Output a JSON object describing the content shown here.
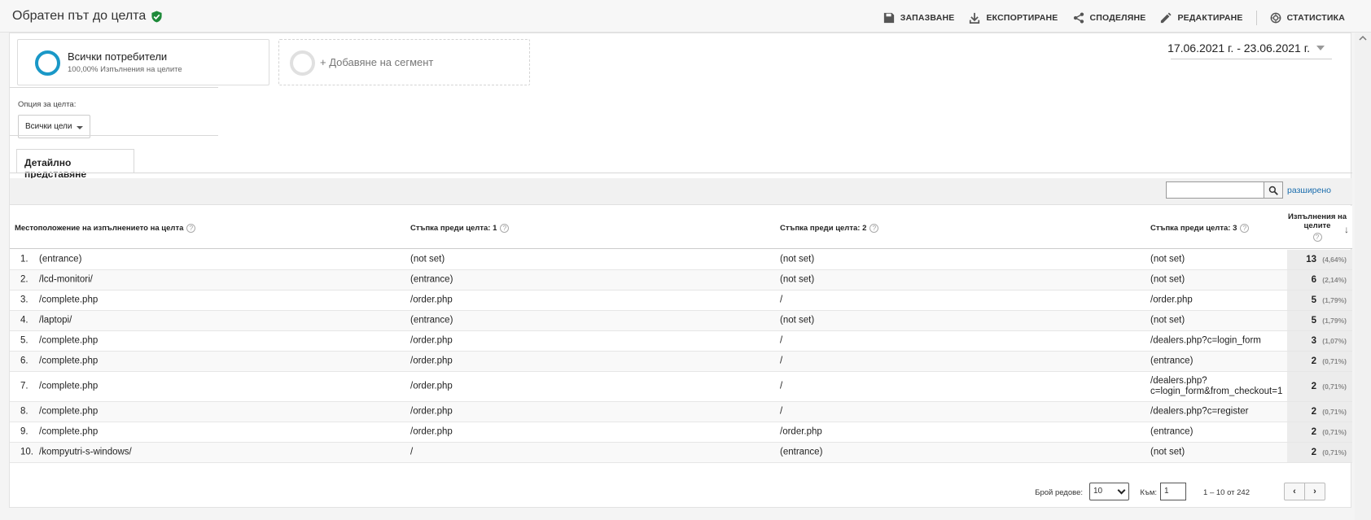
{
  "header": {
    "title": "Обратен път до целта",
    "actions": {
      "save": "ЗАПАЗВАНЕ",
      "export": "ЕКСПОРТИРАНЕ",
      "share": "СПОДЕЛЯНЕ",
      "edit": "РЕДАКТИРАНЕ",
      "insights": "СТАТИСТИКА"
    }
  },
  "segments": {
    "active": {
      "name": "Всички потребители",
      "sub": "100,00% Изпълнения на целите"
    },
    "add_label": "+ Добавяне на сегмент"
  },
  "date_range": "17.06.2021 г. - 23.06.2021 г.",
  "goal_option": {
    "label": "Опция за целта:",
    "value": "Всички цели"
  },
  "tab": "Детайлно представяне",
  "search": {
    "advanced": "разширено"
  },
  "table": {
    "headers": {
      "location": "Местоположение на изпълнението на целта",
      "step1": "Стъпка преди целта: 1",
      "step2": "Стъпка преди целта: 2",
      "step3": "Стъпка преди целта: 3",
      "metric": "Изпълнения на целите",
      "help": "?"
    },
    "rows": [
      {
        "num": "1.",
        "loc": "(entrance)",
        "s1": "(not set)",
        "s2": "(not set)",
        "s3": "(not set)",
        "val": "13",
        "pct": "(4,64%)"
      },
      {
        "num": "2.",
        "loc": "/lcd-monitori/",
        "s1": "(entrance)",
        "s2": "(not set)",
        "s3": "(not set)",
        "val": "6",
        "pct": "(2,14%)"
      },
      {
        "num": "3.",
        "loc": "/complete.php",
        "s1": "/order.php",
        "s2": "/",
        "s3": "/order.php",
        "val": "5",
        "pct": "(1,79%)"
      },
      {
        "num": "4.",
        "loc": "/laptopi/",
        "s1": "(entrance)",
        "s2": "(not set)",
        "s3": "(not set)",
        "val": "5",
        "pct": "(1,79%)"
      },
      {
        "num": "5.",
        "loc": "/complete.php",
        "s1": "/order.php",
        "s2": "/",
        "s3": "/dealers.php?c=login_form",
        "val": "3",
        "pct": "(1,07%)"
      },
      {
        "num": "6.",
        "loc": "/complete.php",
        "s1": "/order.php",
        "s2": "/",
        "s3": "(entrance)",
        "val": "2",
        "pct": "(0,71%)"
      },
      {
        "num": "7.",
        "loc": "/complete.php",
        "s1": "/order.php",
        "s2": "/",
        "s3a": "/dealers.php?",
        "s3b": "c=login_form&from_checkout=1",
        "val": "2",
        "pct": "(0,71%)"
      },
      {
        "num": "8.",
        "loc": "/complete.php",
        "s1": "/order.php",
        "s2": "/",
        "s3": "/dealers.php?c=register",
        "val": "2",
        "pct": "(0,71%)"
      },
      {
        "num": "9.",
        "loc": "/complete.php",
        "s1": "/order.php",
        "s2": "/order.php",
        "s3": "(entrance)",
        "val": "2",
        "pct": "(0,71%)"
      },
      {
        "num": "10.",
        "loc": "/kompyutri-s-windows/",
        "s1": "/",
        "s2": "(entrance)",
        "s3": "(not set)",
        "val": "2",
        "pct": "(0,71%)"
      }
    ]
  },
  "pagination": {
    "rows_label": "Брой редове:",
    "rows_value": "10",
    "goto_label": "Към:",
    "goto_value": "1",
    "range": "1 – 10 от 242",
    "prev": "‹",
    "next": "›"
  }
}
